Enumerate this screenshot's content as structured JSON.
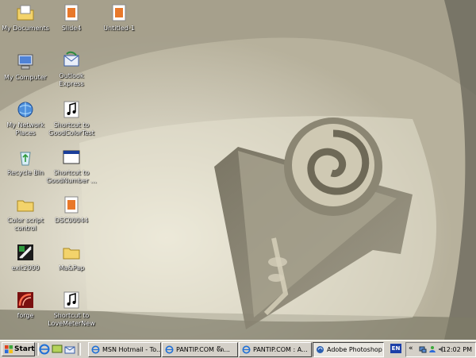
{
  "desktop": {
    "icons": [
      {
        "label": "My Documents",
        "icon": "my-documents-icon"
      },
      {
        "label": "Slide4",
        "icon": "image-file-icon"
      },
      {
        "label": "Untitled-1",
        "icon": "image-file-icon"
      },
      {
        "label": "My Computer",
        "icon": "my-computer-icon"
      },
      {
        "label": "Outlook Express",
        "icon": "outlook-express-icon"
      },
      {
        "label": "My Network Places",
        "icon": "network-places-icon"
      },
      {
        "label": "Shortcut to GoodColorTest",
        "icon": "music-shortcut-icon"
      },
      {
        "label": "Recycle Bin",
        "icon": "recycle-bin-icon"
      },
      {
        "label": "Shortcut to GoodNumber ...",
        "icon": "app-window-shortcut-icon"
      },
      {
        "label": "Color script control",
        "icon": "folder-icon"
      },
      {
        "label": "DSC00044",
        "icon": "image-file-icon"
      },
      {
        "label": "exit2000",
        "icon": "app-icon"
      },
      {
        "label": "Ma&Pap",
        "icon": "folder-icon"
      },
      {
        "label": "forge",
        "icon": "forge-app-icon"
      },
      {
        "label": "Shortcut to LoveMeterNew",
        "icon": "music-shortcut-icon"
      }
    ]
  },
  "taskbar": {
    "start_label": "Start",
    "tasks": [
      {
        "label": "MSN Hotmail - To...",
        "icon": "ie-icon",
        "active": false
      },
      {
        "label": "PANTIP.COM จ๊ด...",
        "icon": "ie-icon",
        "active": false
      },
      {
        "label": "PANTIP.COM : A...",
        "icon": "ie-icon",
        "active": false
      },
      {
        "label": "Adobe Photoshop",
        "icon": "photoshop-icon",
        "active": true
      }
    ],
    "language": "EN",
    "clock": "12:02 PM"
  },
  "colors": {
    "taskbar": "#d4d0c8",
    "wallpaper_base": "#b9b49e"
  }
}
